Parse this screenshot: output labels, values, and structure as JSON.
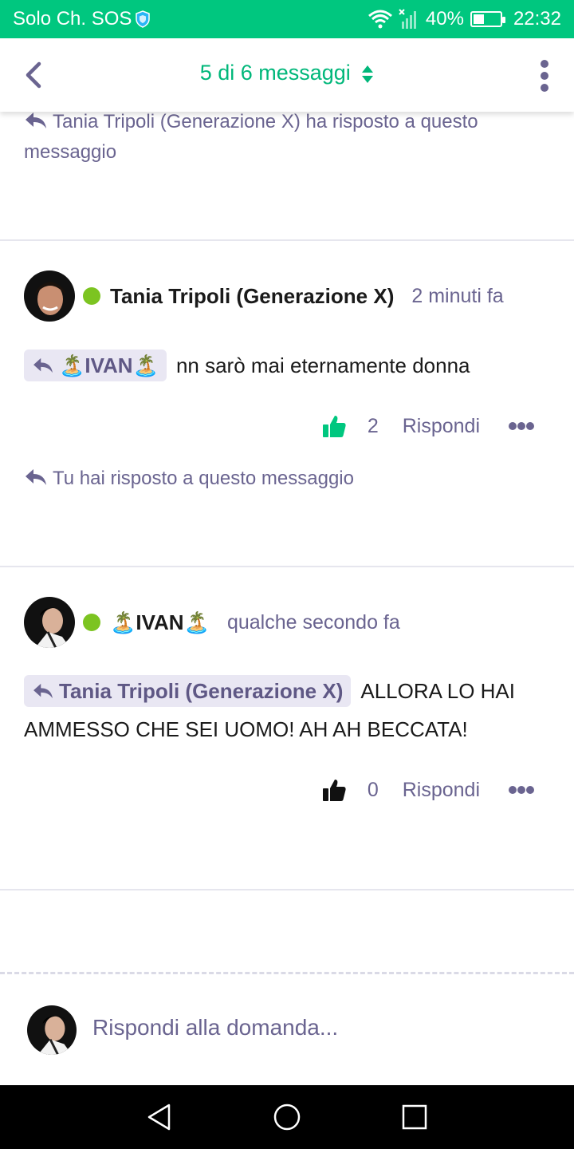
{
  "status_bar": {
    "carrier": "Solo Ch. SOS",
    "battery": "40%",
    "battery_level": 0.4,
    "time": "22:32"
  },
  "header": {
    "title": "5 di 6 messaggi"
  },
  "top_note": {
    "text": "Tania Tripoli (Generazione X) ha risposto a questo messaggio"
  },
  "posts": [
    {
      "author": "Tania Tripoli (Generazione X)",
      "time": "2 minuti fa",
      "mention": "🏝️IVAN🏝️",
      "text": "nn sarò mai eternamente donna",
      "likes": "2",
      "liked": true,
      "reply_label": "Rispondi",
      "note": "Tu hai risposto a questo messaggio"
    },
    {
      "author": "🏝️IVAN🏝️",
      "time": "qualche secondo fa",
      "mention": "Tania Tripoli (Generazione X)",
      "text": "ALLORA LO HAI AMMESSO CHE SEI UOMO! AH AH BECCATA!",
      "likes": "0",
      "liked": false,
      "reply_label": "Rispondi"
    }
  ],
  "composer": {
    "placeholder": "Rispondi alla domanda..."
  },
  "colors": {
    "accent": "#00c77f",
    "purple": "#6a6490",
    "online": "#7cc421"
  }
}
